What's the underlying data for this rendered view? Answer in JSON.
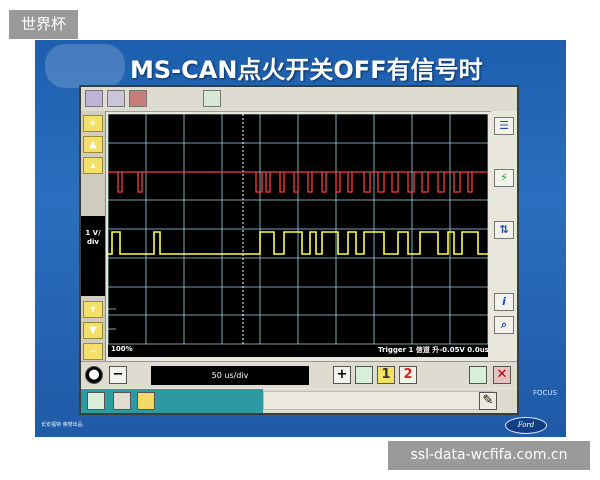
{
  "watermark_top": "世界杯",
  "watermark_bottom": "ssl-data-wcfifa.com.cn",
  "slide": {
    "title": "MS-CAN点火开关OFF有信号时",
    "footer_left": "长安福特 荣誉出品",
    "brand_badge": "Ford",
    "brand_model": "FOCUS"
  },
  "scope": {
    "volts_per_div": "1 V/",
    "volts_unit": "div",
    "zoom": "100%",
    "trigger": "Trigger 1 信道 升-0.05V 0.0us",
    "timebase": "50 us/div",
    "channel1_color": "#ff3b3b",
    "channel2_color": "#ffff4a",
    "grid_color": "#9ad7e0"
  },
  "buttons": {
    "minus": "−",
    "plus": "+",
    "num1": "1",
    "num2": "2",
    "stop": "●"
  },
  "icons": [
    "list-icon",
    "runner-icon",
    "people-icon",
    "info-icon",
    "zoom-icon",
    "graph-icon",
    "close-icon"
  ]
}
